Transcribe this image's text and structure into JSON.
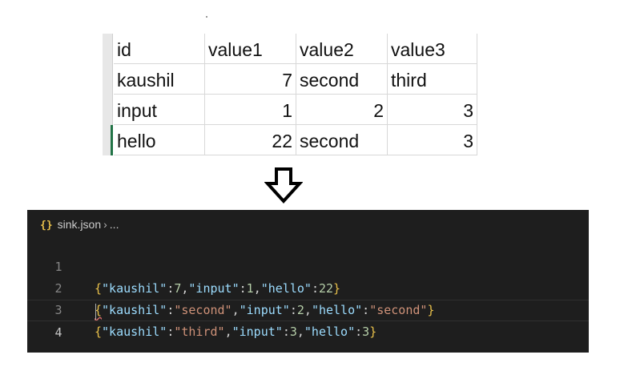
{
  "sheet": {
    "headers": [
      "id",
      "value1",
      "value2",
      "value3"
    ],
    "rows": [
      [
        "kaushil",
        "7",
        "second",
        "third"
      ],
      [
        "input",
        "1",
        "2",
        "3"
      ],
      [
        "hello",
        "22",
        "second",
        "3"
      ]
    ]
  },
  "arrow": {
    "icon": "outline-down-arrow-icon"
  },
  "editor": {
    "breadcrumb": {
      "file": "sink.json",
      "more": "..."
    },
    "colors": {
      "background": "#1e1e1e",
      "key": "#9cdcfe",
      "string": "#ce9178",
      "number": "#b5cea8",
      "brace": "#e8c04a"
    },
    "lines": [
      {
        "number": "1",
        "tokens": [
          {
            "t": "brace",
            "v": "{"
          },
          {
            "t": "key",
            "v": "\"kaushil\""
          },
          {
            "t": "punc",
            "v": ":"
          },
          {
            "t": "numv",
            "v": "7"
          },
          {
            "t": "punc",
            "v": ","
          },
          {
            "t": "key",
            "v": "\"input\""
          },
          {
            "t": "punc",
            "v": ":"
          },
          {
            "t": "numv",
            "v": "1"
          },
          {
            "t": "punc",
            "v": ","
          },
          {
            "t": "key",
            "v": "\"hello\""
          },
          {
            "t": "punc",
            "v": ":"
          },
          {
            "t": "numv",
            "v": "22"
          },
          {
            "t": "brace",
            "v": "}"
          }
        ]
      },
      {
        "number": "2",
        "tokens": [
          {
            "t": "brace squiggle",
            "v": "{"
          },
          {
            "t": "key",
            "v": "\"kaushil\""
          },
          {
            "t": "punc",
            "v": ":"
          },
          {
            "t": "str",
            "v": "\"second\""
          },
          {
            "t": "punc",
            "v": ","
          },
          {
            "t": "key",
            "v": "\"input\""
          },
          {
            "t": "punc",
            "v": ":"
          },
          {
            "t": "numv",
            "v": "2"
          },
          {
            "t": "punc",
            "v": ","
          },
          {
            "t": "key",
            "v": "\"hello\""
          },
          {
            "t": "punc",
            "v": ":"
          },
          {
            "t": "str",
            "v": "\"second\""
          },
          {
            "t": "brace",
            "v": "}"
          }
        ]
      },
      {
        "number": "3",
        "tokens": [
          {
            "t": "brace",
            "v": "{"
          },
          {
            "t": "key",
            "v": "\"kaushil\""
          },
          {
            "t": "punc",
            "v": ":"
          },
          {
            "t": "str",
            "v": "\"third\""
          },
          {
            "t": "punc",
            "v": ","
          },
          {
            "t": "key",
            "v": "\"input\""
          },
          {
            "t": "punc",
            "v": ":"
          },
          {
            "t": "numv",
            "v": "3"
          },
          {
            "t": "punc",
            "v": ","
          },
          {
            "t": "key",
            "v": "\"hello\""
          },
          {
            "t": "punc",
            "v": ":"
          },
          {
            "t": "numv",
            "v": "3"
          },
          {
            "t": "brace",
            "v": "}"
          }
        ]
      },
      {
        "number": "4",
        "tokens": []
      }
    ]
  }
}
